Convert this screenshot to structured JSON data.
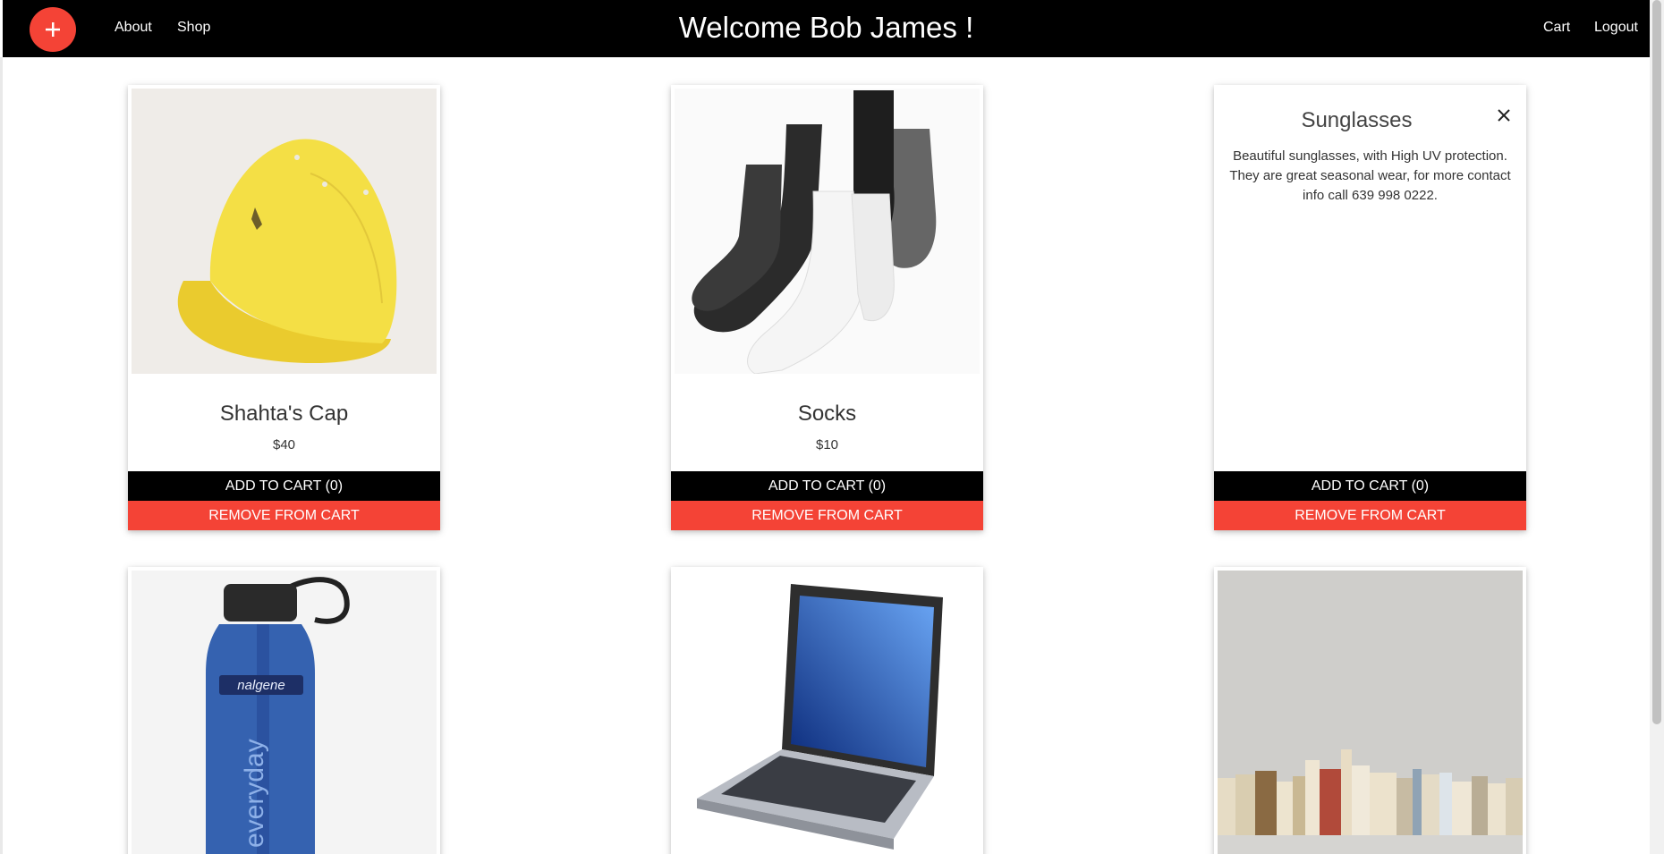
{
  "nav": {
    "add_icon": "plus-icon",
    "links_left": [
      {
        "label": "About"
      },
      {
        "label": "Shop"
      }
    ],
    "title": "Welcome Bob James !",
    "links_right": [
      {
        "label": "Cart"
      },
      {
        "label": "Logout"
      }
    ],
    "accent_color": "#f44336"
  },
  "products": [
    {
      "title": "Shahta's Cap",
      "price": "$40",
      "add_label": "ADD TO CART (0)",
      "remove_label": "REMOVE FROM CART",
      "image": "yellow-cap"
    },
    {
      "title": "Socks",
      "price": "$10",
      "add_label": "ADD TO CART (0)",
      "remove_label": "REMOVE FROM CART",
      "image": "socks"
    },
    {
      "title": "Sunglasses",
      "description": "Beautiful sunglasses, with High UV protection. They are great seasonal wear, for more contact info call 639 998 0222.",
      "add_label": "ADD TO CART (0)",
      "remove_label": "REMOVE FROM CART",
      "close_icon": "close-icon"
    },
    {
      "image": "water-bottle",
      "brand_text": "nalgene",
      "side_text": "everyday"
    },
    {
      "image": "laptop"
    },
    {
      "image": "books"
    }
  ]
}
